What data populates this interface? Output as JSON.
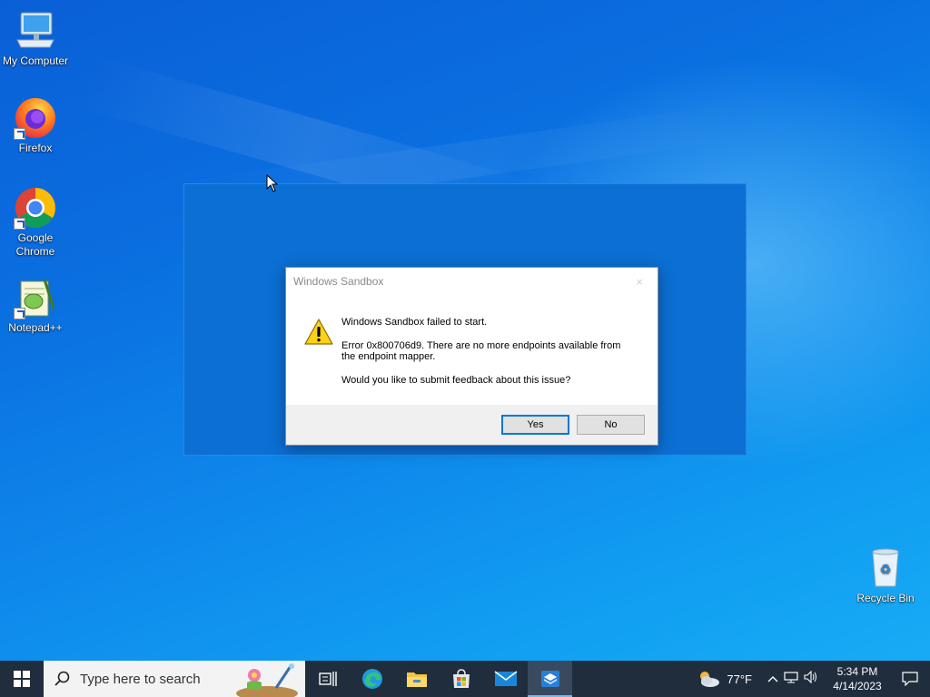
{
  "desktop": {
    "icons": [
      {
        "label": "My Computer"
      },
      {
        "label": "Firefox"
      },
      {
        "label": "Google Chrome"
      },
      {
        "label": "Notepad++"
      },
      {
        "label": "Recycle Bin"
      }
    ]
  },
  "dialog": {
    "title": "Windows Sandbox",
    "close_glyph": "×",
    "icon": "warning-icon",
    "heading": "Windows Sandbox failed to start.",
    "error_line1": "Error 0x800706d9. There are no more endpoints available from",
    "error_line2": "the endpoint mapper.",
    "question": "Would you like to submit feedback about this issue?",
    "yes_label": "Yes",
    "no_label": "No"
  },
  "taskbar": {
    "search_placeholder": "Type here to search",
    "pinned": [
      "task-view-icon",
      "edge-icon",
      "file-explorer-icon",
      "store-icon",
      "mail-icon",
      "sandbox-icon"
    ],
    "weather": "77°F",
    "time": "5:34 PM",
    "date": "4/14/2023"
  },
  "colors": {
    "desktop_accent": "#0a6fe0",
    "sandbox_window": "#0b6fd4",
    "taskbar": "#1f2d3d",
    "default_button_border": "#0078d7"
  }
}
